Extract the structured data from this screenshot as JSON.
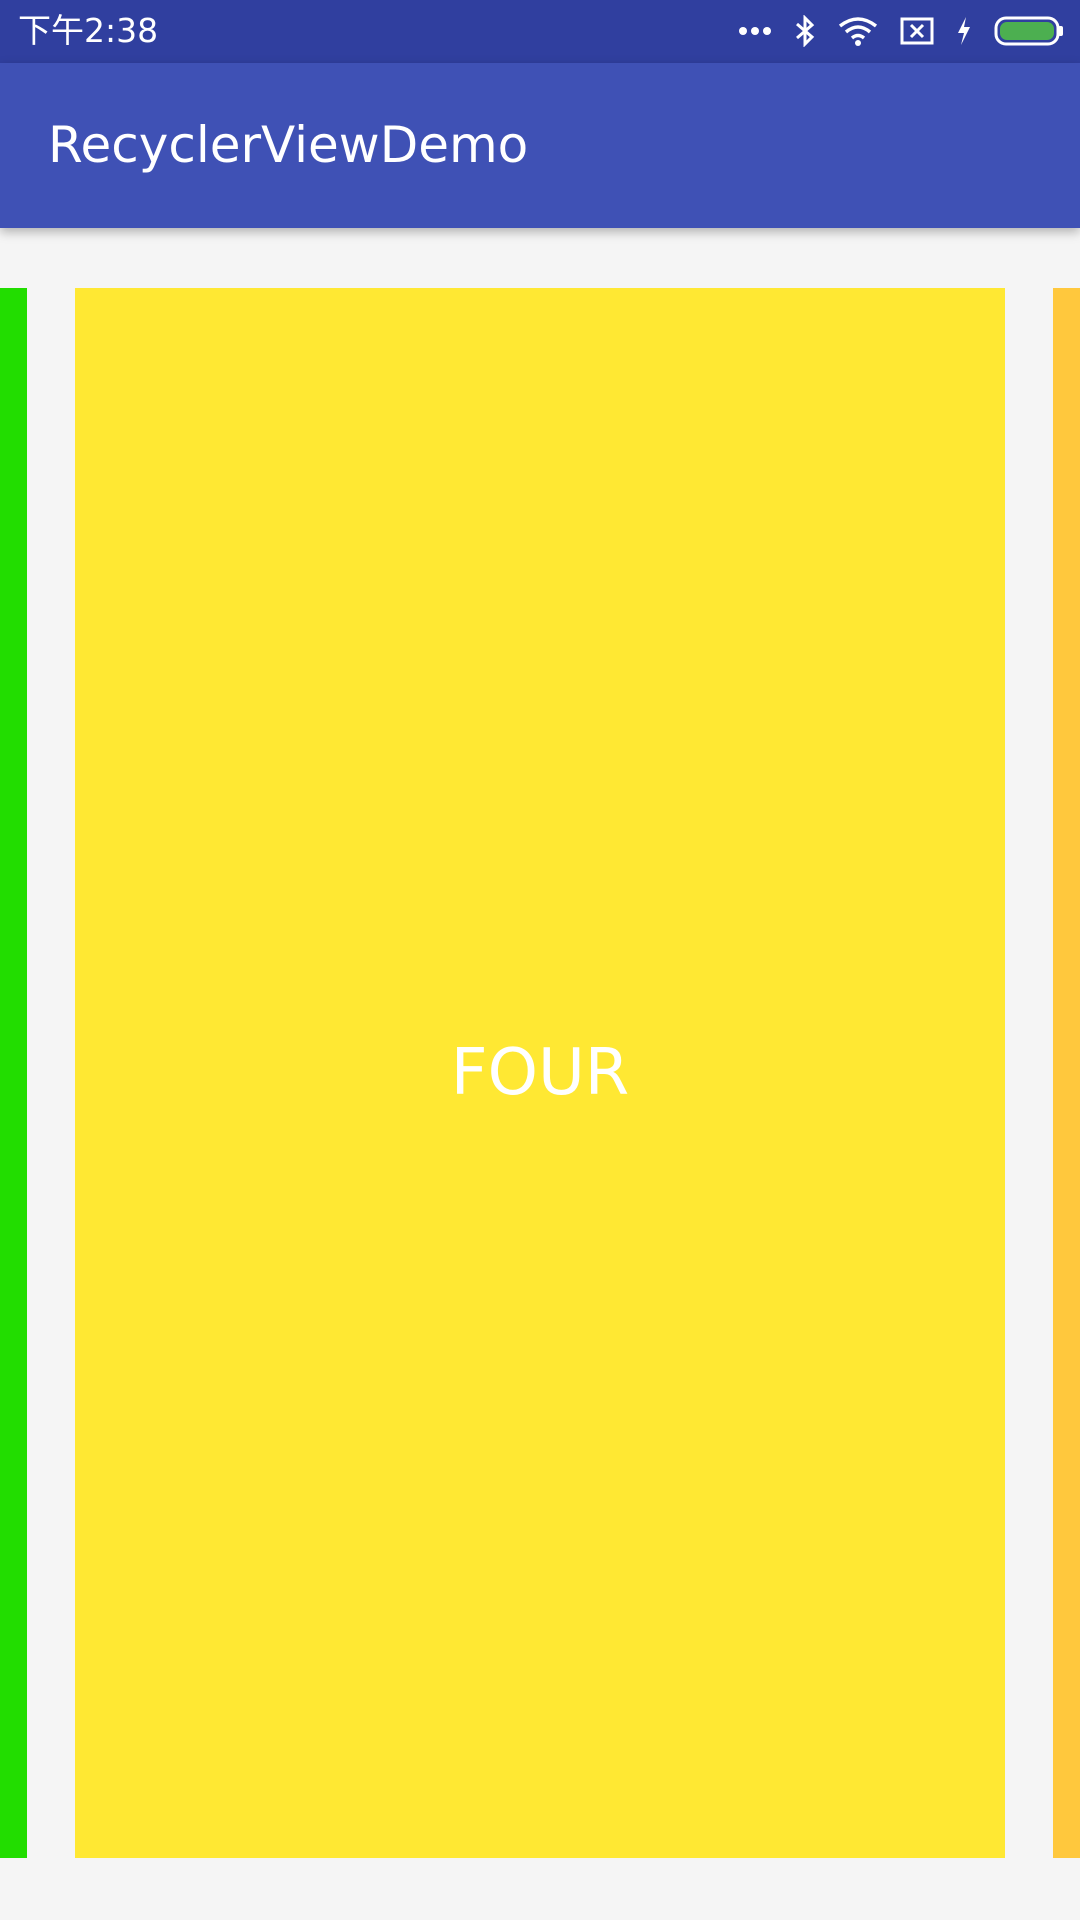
{
  "status_bar": {
    "time": "下午2:38",
    "background": "#303f9f",
    "icons": [
      "more-dots-icon",
      "bluetooth-icon",
      "wifi-icon",
      "no-sim-icon",
      "charging-icon",
      "battery-icon"
    ],
    "battery_color": "#4caf50"
  },
  "app_bar": {
    "title": "RecyclerViewDemo",
    "background": "#3f51b5"
  },
  "carousel": {
    "background": "#f5f5f5",
    "cards": [
      {
        "label": "",
        "color": "#22dd00"
      },
      {
        "label": "FOUR",
        "color": "#ffe833"
      },
      {
        "label": "",
        "color": "#ffc83d"
      }
    ]
  }
}
